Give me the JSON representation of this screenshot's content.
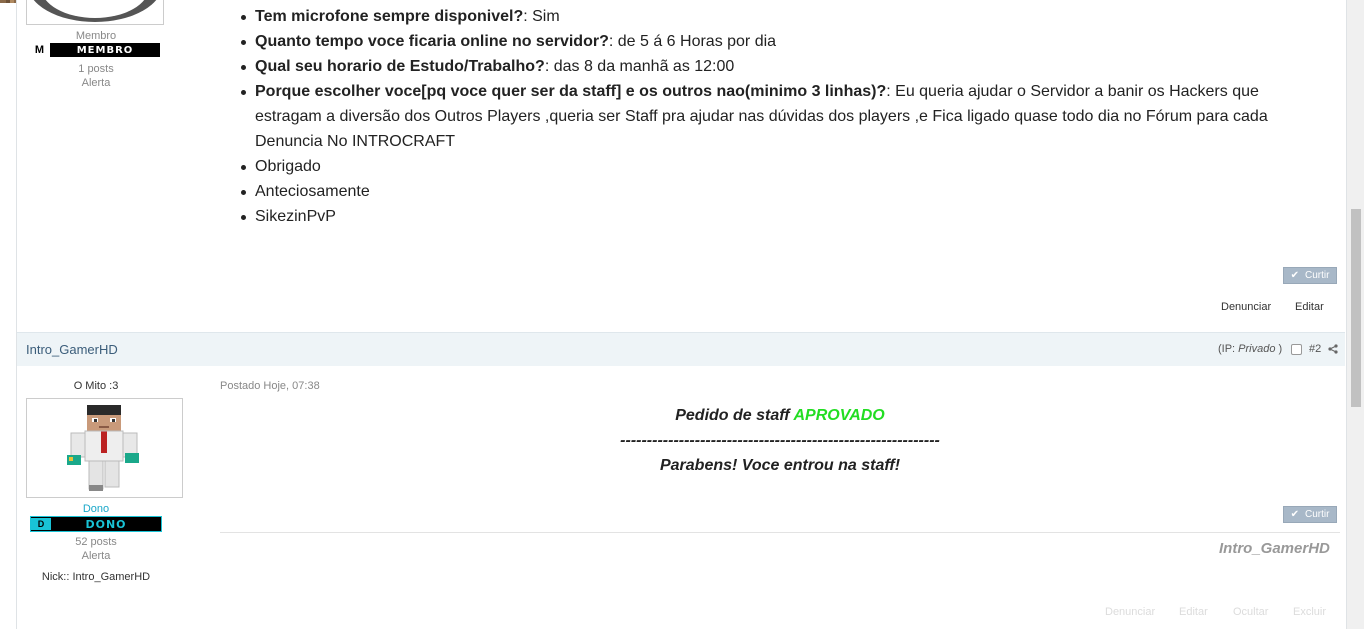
{
  "post1": {
    "author_rank": "Membro",
    "badge_text": "MEMBRO",
    "badge_letter": "M",
    "posts": "1 posts",
    "alert": "Alerta",
    "items": [
      {
        "q": "Tem microfone sempre disponivel?",
        "a": ": Sim"
      },
      {
        "q": "Quanto tempo voce ficaria online no servidor?",
        "a": ": de 5 á 6 Horas por dia"
      },
      {
        "q": "Qual seu horario de Estudo/Trabalho?",
        "a": ": das 8 da manhã as 12:00"
      },
      {
        "q": "Porque escolher voce[pq voce quer ser da staff] e os outros nao(minimo 3 linhas)?",
        "a": ": Eu queria ajudar o Servidor a banir os Hackers que estragam a diversão dos Outros Players ,queria ser Staff pra ajudar nas dúvidas dos players ,e Fica ligado quase todo dia no Fórum para cada Denuncia No INTROCRAFT"
      },
      {
        "q": "",
        "a": "Obrigado"
      },
      {
        "q": "",
        "a": "Anteciosamente"
      },
      {
        "q": "",
        "a": "SikezinPvP"
      }
    ],
    "like_label": "Curtir",
    "report_label": "Denunciar",
    "edit_label": "Editar"
  },
  "post2": {
    "author": "Intro_GamerHD",
    "ip_prefix": "(IP: ",
    "ip_value": "Privado",
    "ip_suffix": " )",
    "post_number": "#2",
    "user_title": "O Mito :3",
    "rank": "Dono",
    "badge_text": "DONO",
    "badge_letter": "D",
    "posts": "52 posts",
    "alert": "Alerta",
    "nick": "Nick:: Intro_GamerHD",
    "date": "Postado Hoje, 07:38",
    "body_line1_prefix": "Pedido de staff ",
    "body_line1_highlight": "APROVADO",
    "body_line2": "------------------------------------------------------------",
    "body_line3": "Parabens! Voce entrou na staff!",
    "like_label": "Curtir",
    "signature": "Intro_GamerHD",
    "actions": [
      "Denunciar",
      "Editar",
      "Ocultar",
      "Excluir"
    ]
  },
  "colors": {
    "approved": "#22dd22",
    "header_bg": "#eef4f7",
    "author_link": "#3b5d7a",
    "dono_accent": "#19c3d6"
  }
}
